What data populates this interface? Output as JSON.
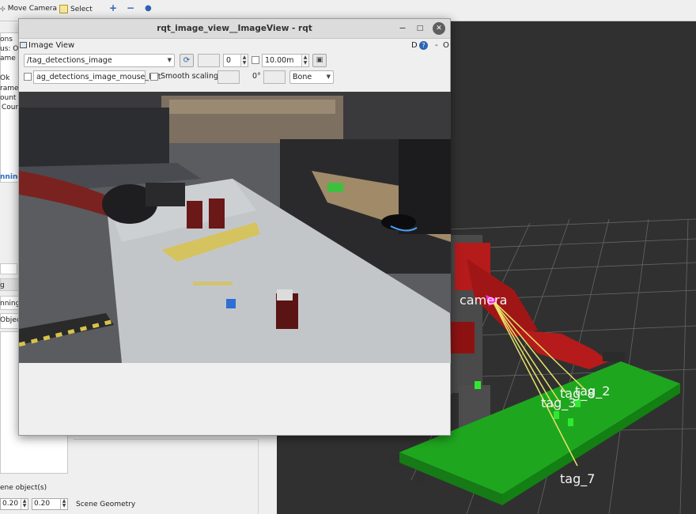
{
  "toolbar": {
    "move_camera": "Move Camera",
    "select": "Select",
    "plus": "+",
    "minus": "−"
  },
  "left_panel": {
    "fragments": [
      "ons",
      "us: Ol",
      "ame",
      "Ok",
      "rame",
      "ount",
      "Cour"
    ],
    "running_link": "nning",
    "g": "g",
    "running2": "nning",
    "object": "Object",
    "scene_objects": "ene object(s)",
    "spin_a": "0.20",
    "spin_b": "0.20",
    "scene_geometry": "Scene Geometry"
  },
  "window": {
    "title": "rqt_image_view__ImageView - rqt",
    "plugin_title": "Image View",
    "help_label": "D",
    "dash": "-",
    "o": "O"
  },
  "controls": {
    "topic": "/tag_detections_image",
    "box_value": "",
    "spin_value": "0",
    "distance": "10.00m",
    "mouse_topic": "ag_detections_image_mouse_left",
    "smooth_scaling": "Smooth scaling",
    "rotation": "0°",
    "colormap": "Bone"
  },
  "scene": {
    "labels": [
      "camera",
      "tag_8",
      "tag_2",
      "tag_3",
      "tag_7"
    ]
  },
  "colors": {
    "tag_lines": "#e8e36a",
    "table_green": "#1fa61f",
    "camera_marker": "#ff2bd6",
    "robot_red": "#b51b1b"
  }
}
